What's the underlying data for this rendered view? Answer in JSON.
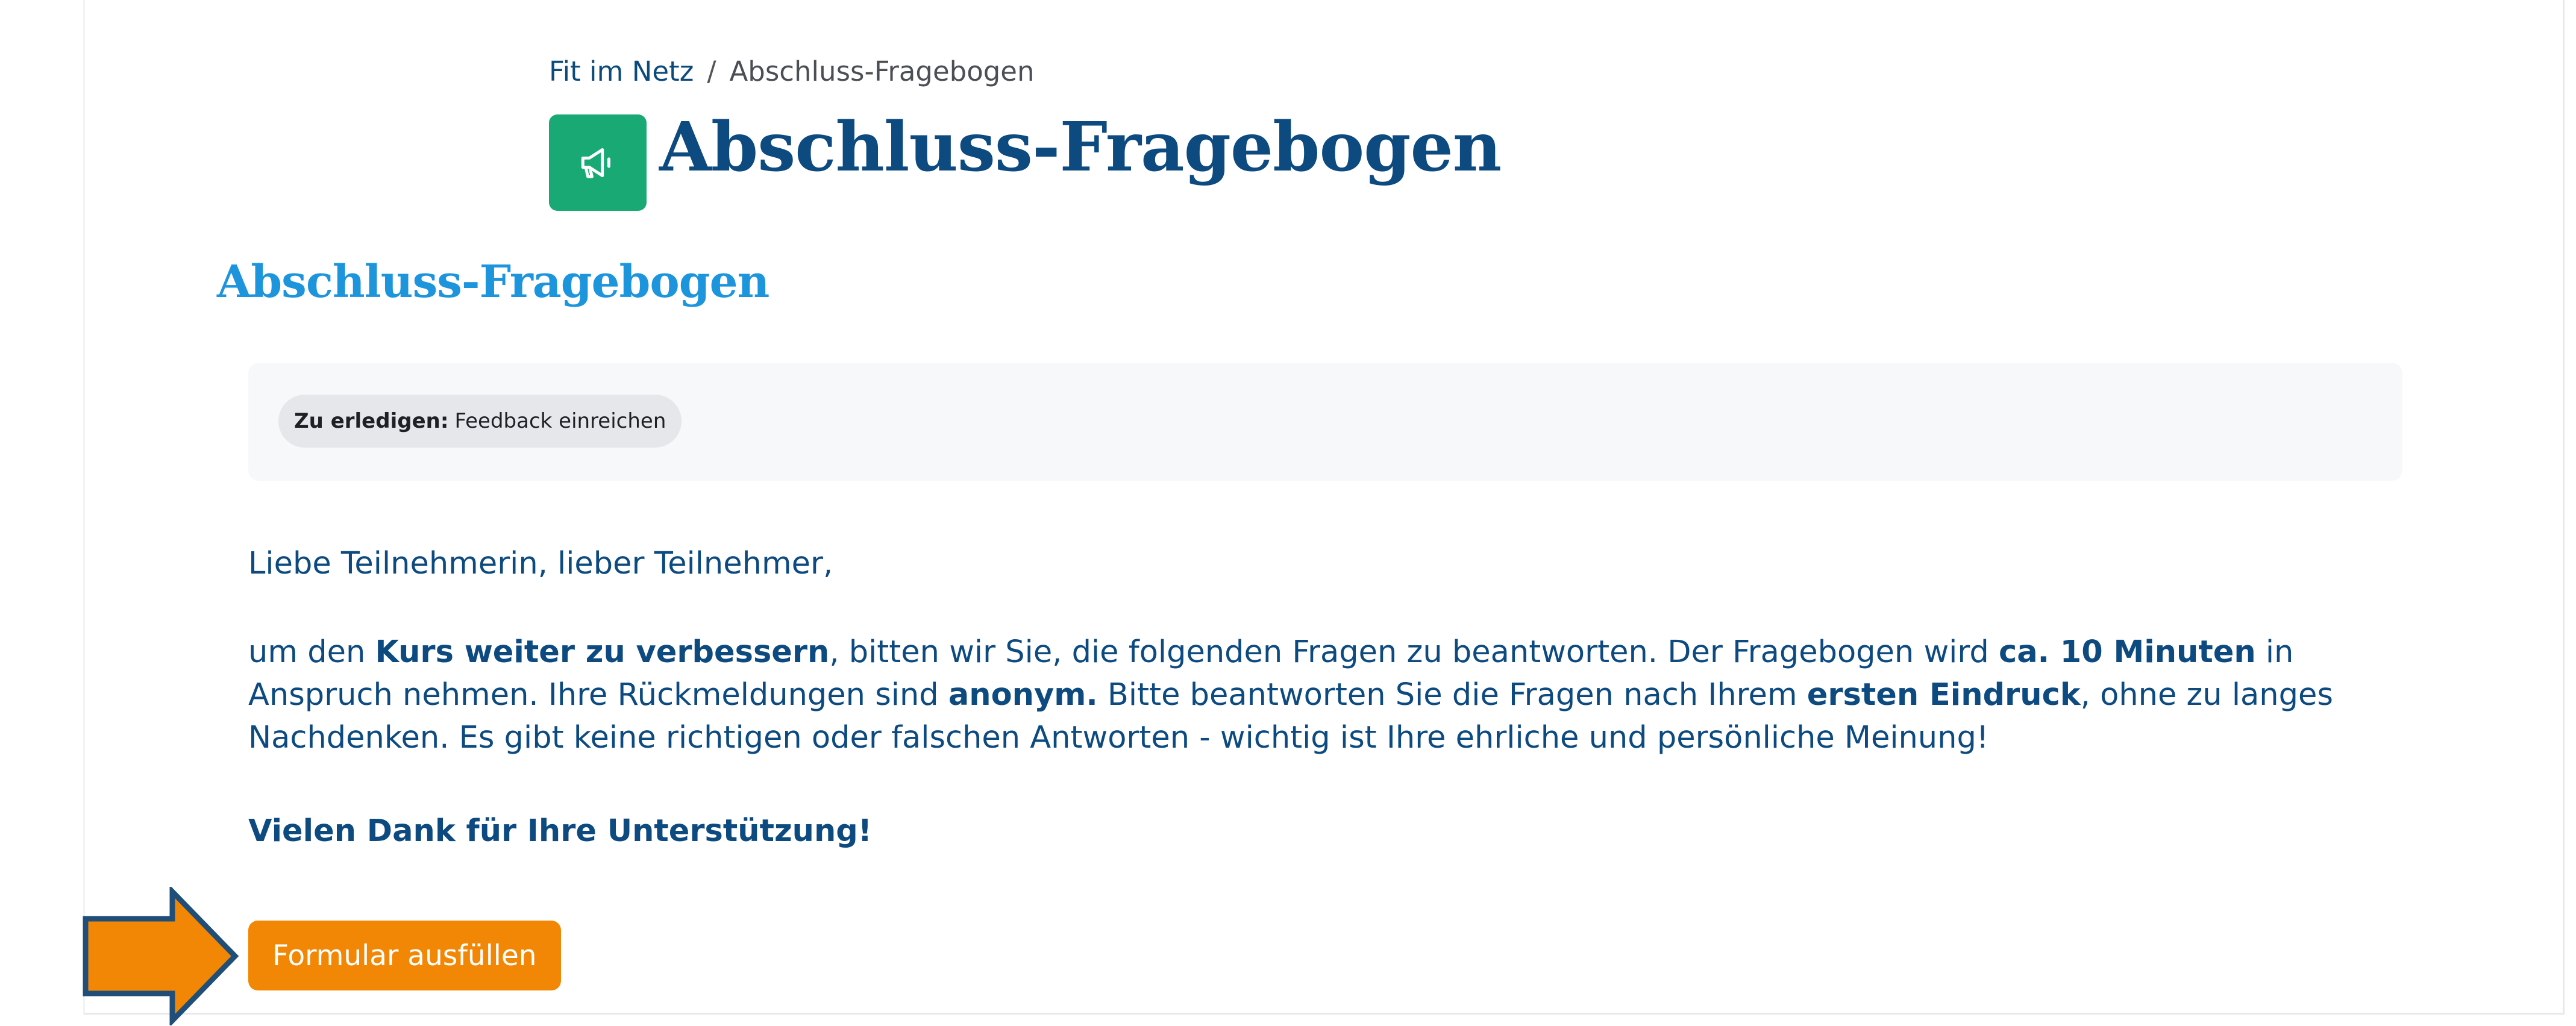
{
  "breadcrumb": {
    "course": "Fit im Netz",
    "separator": "/",
    "current": "Abschluss-Fragebogen"
  },
  "header": {
    "title": "Abschluss-Fragebogen",
    "icon": "megaphone-icon",
    "icon_color": "#19a974"
  },
  "activity": {
    "heading": "Abschluss-Fragebogen",
    "todo_label": "Zu erledigen:",
    "todo_value": "Feedback einreichen"
  },
  "content": {
    "greeting": "Liebe Teilnehmerin, lieber Teilnehmer,",
    "intro_1": "um den ",
    "intro_b1": "Kurs weiter zu verbessern",
    "intro_2": ", bitten wir Sie, die folgenden Fragen zu beantworten. Der Fragebogen wird ",
    "intro_b2": "ca. 10 Minuten",
    "intro_3": " in Anspruch nehmen. Ihre Rückmeldungen sind ",
    "intro_b3": "anonym.",
    "intro_4": " Bitte beantworten Sie die Fragen nach Ihrem ",
    "intro_b4": "ersten Eindruck",
    "intro_5": ", ohne zu langes Nachdenken. Es gibt keine richtigen oder falschen Antworten - wichtig ist Ihre ehrliche und persönliche Meinung!",
    "thanks": "Vielen Dank für Ihre Unterstützung!"
  },
  "actions": {
    "fill_form_label": "Formular ausfüllen",
    "button_color": "#f28705"
  },
  "annotation": {
    "arrow_icon": "arrow-right-icon",
    "arrow_color": "#f28705",
    "arrow_outline": "#1f4e79"
  }
}
